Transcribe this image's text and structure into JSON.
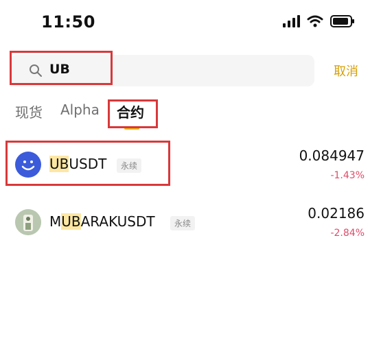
{
  "status": {
    "time": "11:50"
  },
  "search": {
    "value": "UB",
    "cancel_label": "取消"
  },
  "tabs": [
    {
      "label": "现货"
    },
    {
      "label": "Alpha"
    },
    {
      "label": "合约"
    }
  ],
  "results": [
    {
      "symbol_match": "UB",
      "symbol_rest": "USDT",
      "prefix": "",
      "tag": "永续",
      "price": "0.084947",
      "change": "-1.43%"
    },
    {
      "symbol_match": "UB",
      "symbol_rest": "ARAKUSDT",
      "prefix": "M",
      "tag": "永续",
      "price": "0.02186",
      "change": "-2.84%"
    }
  ],
  "colors": {
    "accent": "#f0b90b",
    "negative": "#e04b69",
    "highlight_box": "#d9383a"
  }
}
